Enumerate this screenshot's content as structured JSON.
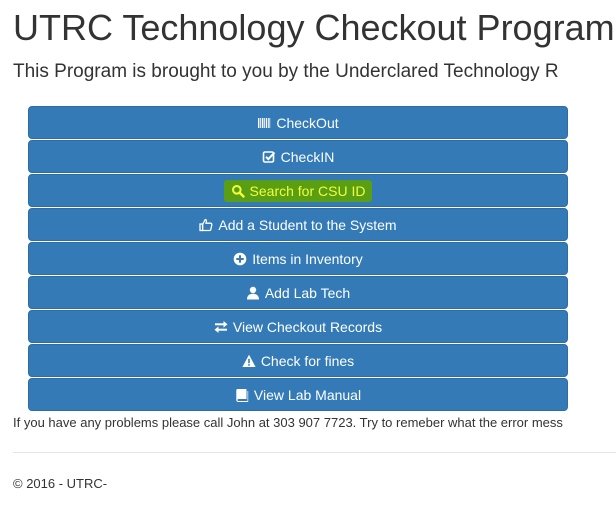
{
  "header": {
    "title": "UTRC Technology Checkout Program",
    "subtitle": "This Program is brought to you by the Underclared Technology R"
  },
  "menu": [
    {
      "label": "CheckOut",
      "icon": "barcode-icon"
    },
    {
      "label": "CheckIN",
      "icon": "check-square-icon"
    },
    {
      "label": "Search for CSU ID",
      "icon": "search-icon",
      "highlighted": true
    },
    {
      "label": "Add a Student to the System",
      "icon": "thumbs-up-icon"
    },
    {
      "label": "Items in Inventory",
      "icon": "plus-circle-icon"
    },
    {
      "label": "Add Lab Tech",
      "icon": "user-icon"
    },
    {
      "label": "View Checkout Records",
      "icon": "transfer-icon"
    },
    {
      "label": "Check for fines",
      "icon": "warning-icon"
    },
    {
      "label": "View Lab Manual",
      "icon": "book-icon"
    }
  ],
  "help_text": "If you have any problems please call John at 303 907 7723. Try to remeber what the error mess",
  "footer": "© 2016 - UTRC-",
  "colors": {
    "button_bg": "#337ab7",
    "button_border": "#2e6da4",
    "highlight_bg": "#5a9e14",
    "highlight_text": "#f2ff3a"
  }
}
